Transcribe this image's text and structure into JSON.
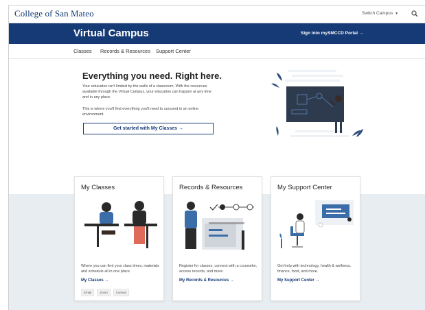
{
  "topbar": {
    "logo": "College of San Mateo",
    "switch_campus": "Switch Campus",
    "search_icon": "search-icon"
  },
  "header": {
    "title": "Virtual Campus",
    "portal_link": "Sign into mySMCCD Portal →"
  },
  "nav": {
    "items": [
      "Classes",
      "Records & Resources",
      "Support Center"
    ]
  },
  "hero": {
    "title": "Everything you need. Right here.",
    "paragraph1": "Your education isn't limited by the walls of a classroom. With the resources available through the Virtual Campus, your education can happen at any time and in any place.",
    "paragraph2": "This is where you'll find everything you'll need to succeed in an online environment.",
    "cta": "Get started with My Classes →"
  },
  "cards": [
    {
      "title": "My Classes",
      "desc": "Where you can find your class times, materials and schedule all in one place",
      "link": "My Classes →",
      "tags": [
        "Email",
        "Zoom",
        "Canvas"
      ]
    },
    {
      "title": "Records & Resources",
      "desc": "Register for classes, connect with a counselor, access records, and more.",
      "link": "My Records & Resources →"
    },
    {
      "title": "My Support Center",
      "desc": "Get help with technology, health & wellness, finance, food, and more.",
      "link": "My Support Center →"
    }
  ],
  "colors": {
    "brand_navy": "#163a75",
    "band": "#e7edf0"
  }
}
